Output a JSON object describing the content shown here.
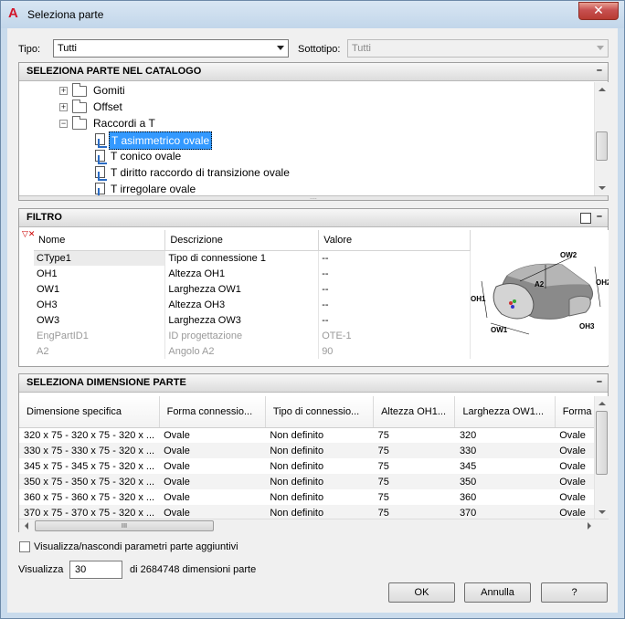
{
  "window": {
    "title": "Seleziona parte"
  },
  "tipo": {
    "label": "Tipo:",
    "value": "Tutti"
  },
  "sottotipo": {
    "label": "Sottotipo:",
    "value": "Tutti"
  },
  "catalog": {
    "header": "SELEZIONA PARTE NEL CATALOGO",
    "collapse": "–",
    "items": [
      {
        "label": "Gomiti",
        "kind": "folder"
      },
      {
        "label": "Offset",
        "kind": "folder"
      },
      {
        "label": "Raccordi a T",
        "kind": "folder-open"
      },
      {
        "label": "T asimmetrico ovale",
        "kind": "part",
        "selected": true
      },
      {
        "label": "T conico ovale",
        "kind": "part"
      },
      {
        "label": "T diritto raccordo di transizione ovale",
        "kind": "part"
      },
      {
        "label": "T irregolare ovale",
        "kind": "part"
      }
    ]
  },
  "filter": {
    "header": "FILTRO",
    "collapse": "–",
    "columns": [
      "Nome",
      "Descrizione",
      "Valore"
    ],
    "rows": [
      [
        "CType1",
        "Tipo di connessione 1",
        "--"
      ],
      [
        "OH1",
        "Altezza OH1",
        "--"
      ],
      [
        "OW1",
        "Larghezza OW1",
        "--"
      ],
      [
        "OH3",
        "Altezza OH3",
        "--"
      ],
      [
        "OW3",
        "Larghezza OW3",
        "--"
      ],
      [
        "EngPartID1",
        "ID progettazione",
        "OTE-1"
      ],
      [
        "A2",
        "Angolo A2",
        "90"
      ]
    ],
    "diagram": {
      "labels": [
        "OW2",
        "OH2",
        "A2",
        "OH1",
        "OW1",
        "OH3"
      ]
    }
  },
  "size": {
    "header": "SELEZIONA DIMENSIONE PARTE",
    "collapse": "–",
    "columns": [
      "Dimensione specifica",
      "Forma connessio...",
      "Tipo di connessio...",
      "Altezza OH1...",
      "Larghezza OW1...",
      "Forma c"
    ],
    "rows": [
      [
        "320 x 75 - 320 x 75 - 320 x ...",
        "Ovale",
        "Non definito",
        "75",
        "320",
        "Ovale"
      ],
      [
        "330 x 75 - 330 x 75 - 320 x ...",
        "Ovale",
        "Non definito",
        "75",
        "330",
        "Ovale"
      ],
      [
        "345 x 75 - 345 x 75 - 320 x ...",
        "Ovale",
        "Non definito",
        "75",
        "345",
        "Ovale"
      ],
      [
        "350 x 75 - 350 x 75 - 320 x ...",
        "Ovale",
        "Non definito",
        "75",
        "350",
        "Ovale"
      ],
      [
        "360 x 75 - 360 x 75 - 320 x ...",
        "Ovale",
        "Non definito",
        "75",
        "360",
        "Ovale"
      ],
      [
        "370 x 75 - 370 x 75 - 320 x ...",
        "Ovale",
        "Non definito",
        "75",
        "370",
        "Ovale"
      ]
    ],
    "hscroll_thumb": "III"
  },
  "footer": {
    "toggle_label": "Visualizza/nascondi parametri parte aggiuntivi",
    "checked": false,
    "show_label": "Visualizza",
    "show_value": "30",
    "count_text": "di 2684748 dimensioni parte",
    "ok": "OK",
    "cancel": "Annulla",
    "help": "?"
  }
}
